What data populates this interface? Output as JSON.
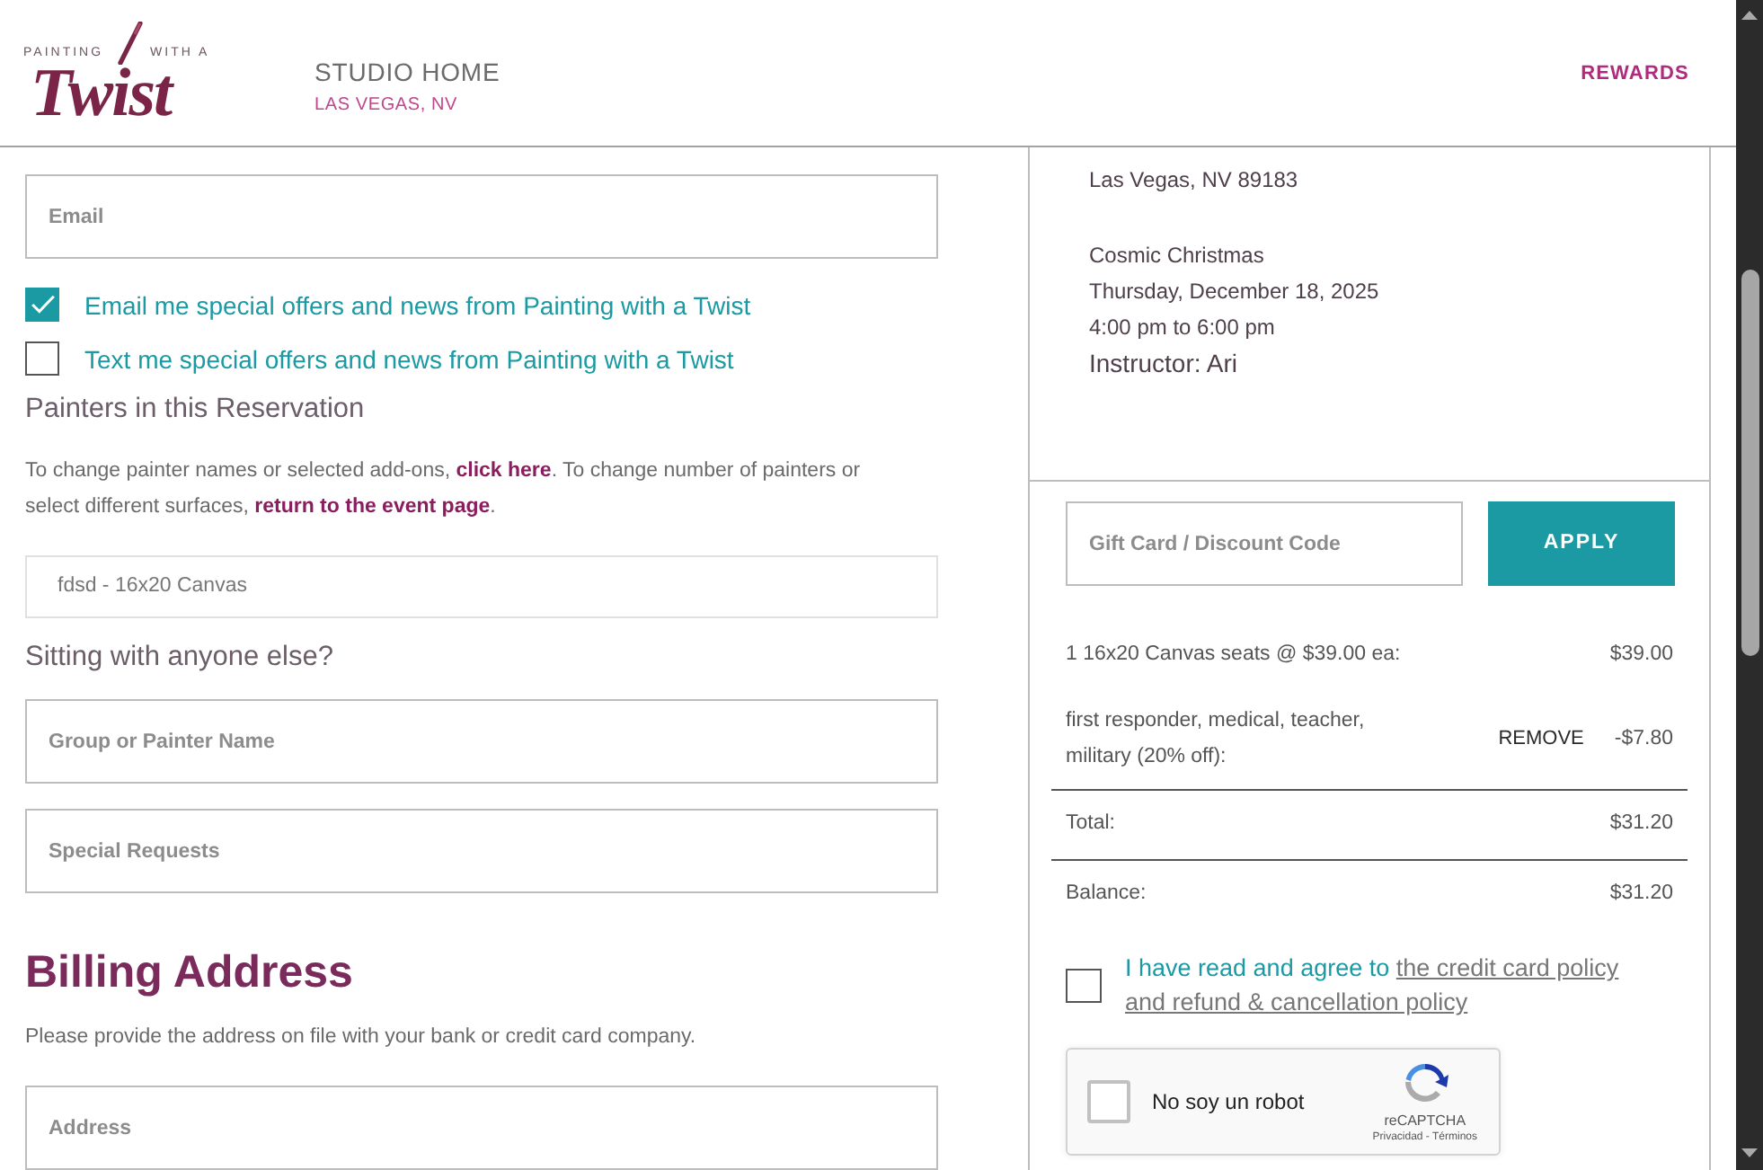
{
  "header": {
    "logo": {
      "top_left": "PAINTING",
      "top_right": "WITH A",
      "wordmark": "Twist"
    },
    "studio_title": "STUDIO HOME",
    "studio_location": "LAS VEGAS, NV",
    "nav_link": "REWARDS"
  },
  "contact": {
    "email_field": {
      "placeholder": "Email"
    },
    "options": [
      {
        "label": "Email me special offers and news from Painting with a Twist",
        "checked": true
      },
      {
        "label": "Text me special offers and news from Painting with a Twist",
        "checked": false
      }
    ]
  },
  "painters": {
    "heading": "Painters in this Reservation",
    "note": [
      {
        "kind": "text",
        "text": "To change painter names or selected add-ons, "
      },
      {
        "kind": "link",
        "text": "click here"
      },
      {
        "kind": "text",
        "text": ". To change number of painters or select different surfaces, "
      },
      {
        "kind": "link",
        "text": "return to the event page"
      },
      {
        "kind": "text",
        "text": "."
      }
    ],
    "selection": {
      "value": "fdsd - 16x20 Canvas"
    },
    "sitting_heading": "Sitting with anyone else?",
    "group_field": {
      "placeholder": "Group or Painter Name"
    },
    "requests_field": {
      "placeholder": "Special Requests"
    }
  },
  "billing": {
    "heading": "Billing Address",
    "note": "Please provide the address on file with your bank or credit card company.",
    "address_field": {
      "placeholder": "Address"
    }
  },
  "summary": {
    "address_lines": [
      "Las Vegas, NV 89183"
    ],
    "event_lines": [
      "Cosmic Christmas",
      "Thursday, December 18, 2025",
      "4:00 pm to 6:00 pm"
    ],
    "instructor": "Instructor: Ari",
    "discount_field": {
      "placeholder": "Gift Card / Discount Code"
    },
    "apply_button": "APPLY",
    "line_items": [
      {
        "label": "1 16x20 Canvas seats @ $39.00 ea:",
        "amount": "$39.00"
      },
      {
        "label": "first responder, medical, teacher, military (20% off):",
        "action": "REMOVE",
        "amount": "-$7.80"
      }
    ],
    "totals": [
      {
        "label": "Total:",
        "amount": "$31.20"
      },
      {
        "label": "Balance:",
        "amount": "$31.20"
      }
    ]
  },
  "agreement": {
    "checked": false,
    "note": [
      {
        "kind": "text",
        "text": "I have read and agree to "
      },
      {
        "kind": "link",
        "text": "the credit card policy"
      },
      {
        "kind": "link",
        "text": "and refund & cancellation policy"
      }
    ]
  },
  "captcha": {
    "checked": false,
    "label": "No soy un robot",
    "brand": "reCAPTCHA",
    "legal": "Privacidad - Términos"
  }
}
